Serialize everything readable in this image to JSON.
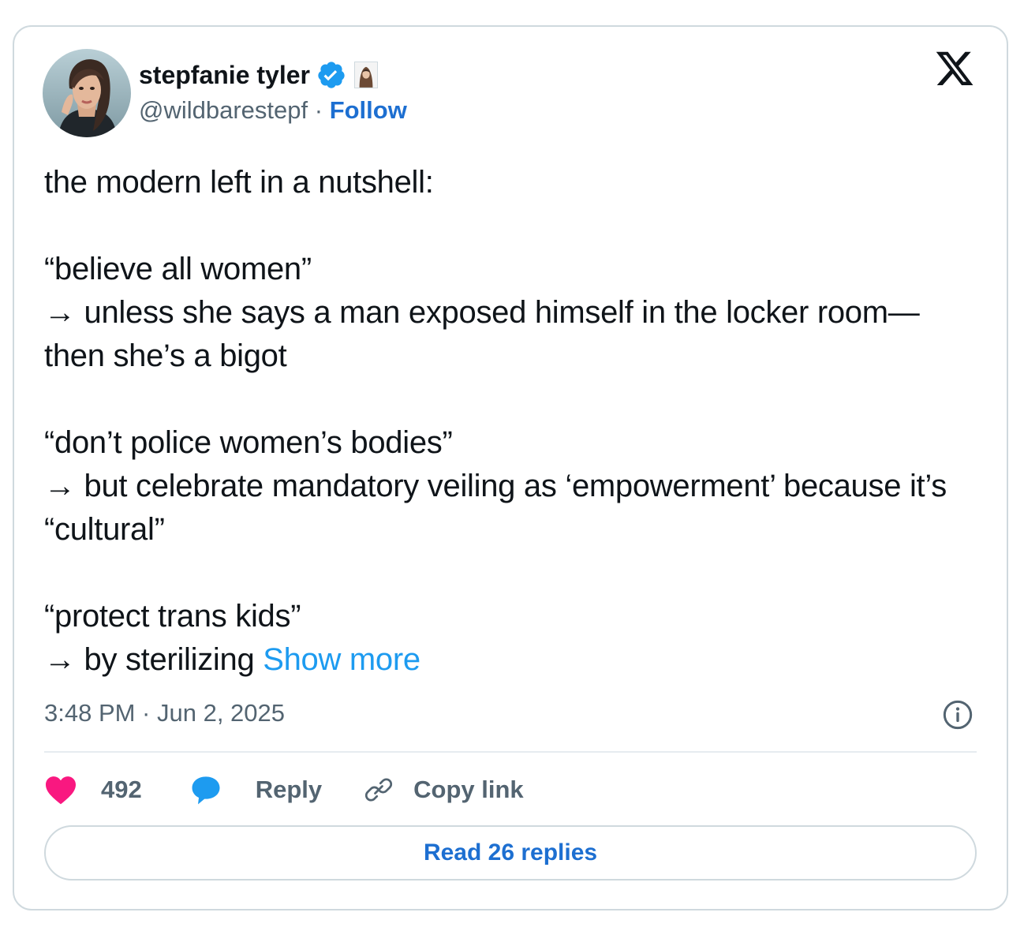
{
  "author": {
    "name": "stepfanie tyler",
    "handle": "@wildbarestepf",
    "separator": " · ",
    "follow_label": "Follow"
  },
  "tweet": {
    "lines": [
      "the modern left in a nutshell:",
      "“believe all women”",
      "→ unless she says a man exposed himself in the locker room—then she’s a bigot",
      "“don’t police women’s bodies”",
      "→ but celebrate mandatory veiling as ‘empowerment’ because it’s “cultural”",
      "“protect trans kids”",
      "→ by sterilizing "
    ],
    "show_more_label": "Show more",
    "timestamp": "3:48 PM · Jun 2, 2025"
  },
  "actions": {
    "like_count": "492",
    "reply_label": "Reply",
    "copy_link_label": "Copy link",
    "read_replies_label": "Read 26 replies"
  },
  "icons": {
    "logo": "x-logo-icon",
    "verified": "verified-badge-icon",
    "info": "info-icon",
    "like": "heart-icon",
    "reply": "speech-bubble-icon",
    "copy": "link-icon"
  },
  "colors": {
    "text": "#0f1419",
    "secondary": "#536471",
    "link": "#1d6fd1",
    "show_more": "#1d9bf0",
    "heart": "#f91880",
    "reply_bubble": "#1d9bf0",
    "verified": "#1d9bf0",
    "border": "#cfd9de"
  }
}
